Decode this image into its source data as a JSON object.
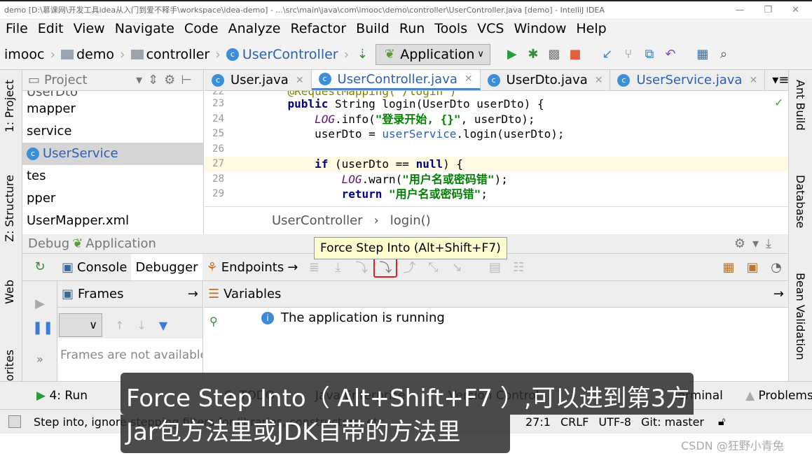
{
  "window": {
    "title": "demo [D:\\慕课网\\开发工具idea从入门到爱不释手\\workspace\\idea-demo] - ...\\src\\main\\java\\com\\imooc\\demo\\controller\\UserController.java [demo] - IntelliJ IDEA",
    "controls": [
      "—",
      "❐",
      "✕"
    ]
  },
  "menu": [
    "File",
    "Edit",
    "View",
    "Navigate",
    "Code",
    "Analyze",
    "Refactor",
    "Build",
    "Run",
    "Tools",
    "VCS",
    "Window",
    "Help"
  ],
  "breadcrumb": [
    "imooc",
    "demo",
    "controller",
    "UserController"
  ],
  "run_config": "Application",
  "left_strip": [
    "1: Project",
    "Z: Structure",
    "Web",
    "orites"
  ],
  "right_strip": [
    "Ant Build",
    "Database",
    "Bean Validation"
  ],
  "project": {
    "title": "Project",
    "items": [
      {
        "label": "UserDto",
        "selected": false
      },
      {
        "label": "mapper",
        "selected": false
      },
      {
        "label": "service",
        "selected": false
      },
      {
        "label": "UserService",
        "selected": true
      },
      {
        "label": "tes",
        "selected": false
      },
      {
        "label": "pper",
        "selected": false
      },
      {
        "label": "UserMapper.xml",
        "selected": false
      }
    ]
  },
  "tabs": [
    {
      "label": "User.java",
      "active": false
    },
    {
      "label": "UserController.java",
      "active": true
    },
    {
      "label": "UserDto.java",
      "active": false
    },
    {
      "label": "UserService.java",
      "active": false
    }
  ],
  "code": [
    {
      "n": "22",
      "t": "    @RequestMapping(\"/login\")"
    },
    {
      "n": "23",
      "t": "    public String login(UserDto userDto) {"
    },
    {
      "n": "24",
      "t": "        LOG.info(\"登录开始, {}\", userDto);"
    },
    {
      "n": "25",
      "t": "        userDto = userService.login(userDto);"
    },
    {
      "n": "26",
      "t": ""
    },
    {
      "n": "27",
      "t": "        if (userDto == null) {"
    },
    {
      "n": "28",
      "t": "            LOG.warn(\"用户名或密码错\");"
    },
    {
      "n": "29",
      "t": "            return \"用户名或密码错\";"
    }
  ],
  "editor_crumb": [
    "UserController",
    "login()"
  ],
  "debug": {
    "label": "Debug",
    "config": "Application",
    "tabs": [
      "Console",
      "Debugger",
      "Endpoints"
    ],
    "tooltip": "Force Step Into (Alt+Shift+F7)",
    "frames_title": "Frames",
    "frames_empty": "Frames are not available",
    "variables_title": "Variables",
    "variables_msg": "The application is running"
  },
  "bottom_tabs": [
    "4: Run",
    "6: TODO",
    "Java Enterprise",
    "Version Control",
    "Terminal",
    "Problems"
  ],
  "status": {
    "message": "Step into, ignore stepping filters for libraries, constructors, etc.",
    "position": "27:1",
    "line_sep": "CRLF",
    "encoding": "UTF-8",
    "vcs": "Git: master"
  },
  "subtitle": {
    "line1": "Force Step Into（ Alt+Shift+F7 ）,可以进到第3方",
    "line2": "Jar包方法里或JDK自带的方法里"
  },
  "watermark": "CSDN @狂野小青兔",
  "colors": {
    "accent": "#2b5fb4",
    "highlight_box": "#e02020",
    "subtitle_bg": "#2d2d2d"
  }
}
